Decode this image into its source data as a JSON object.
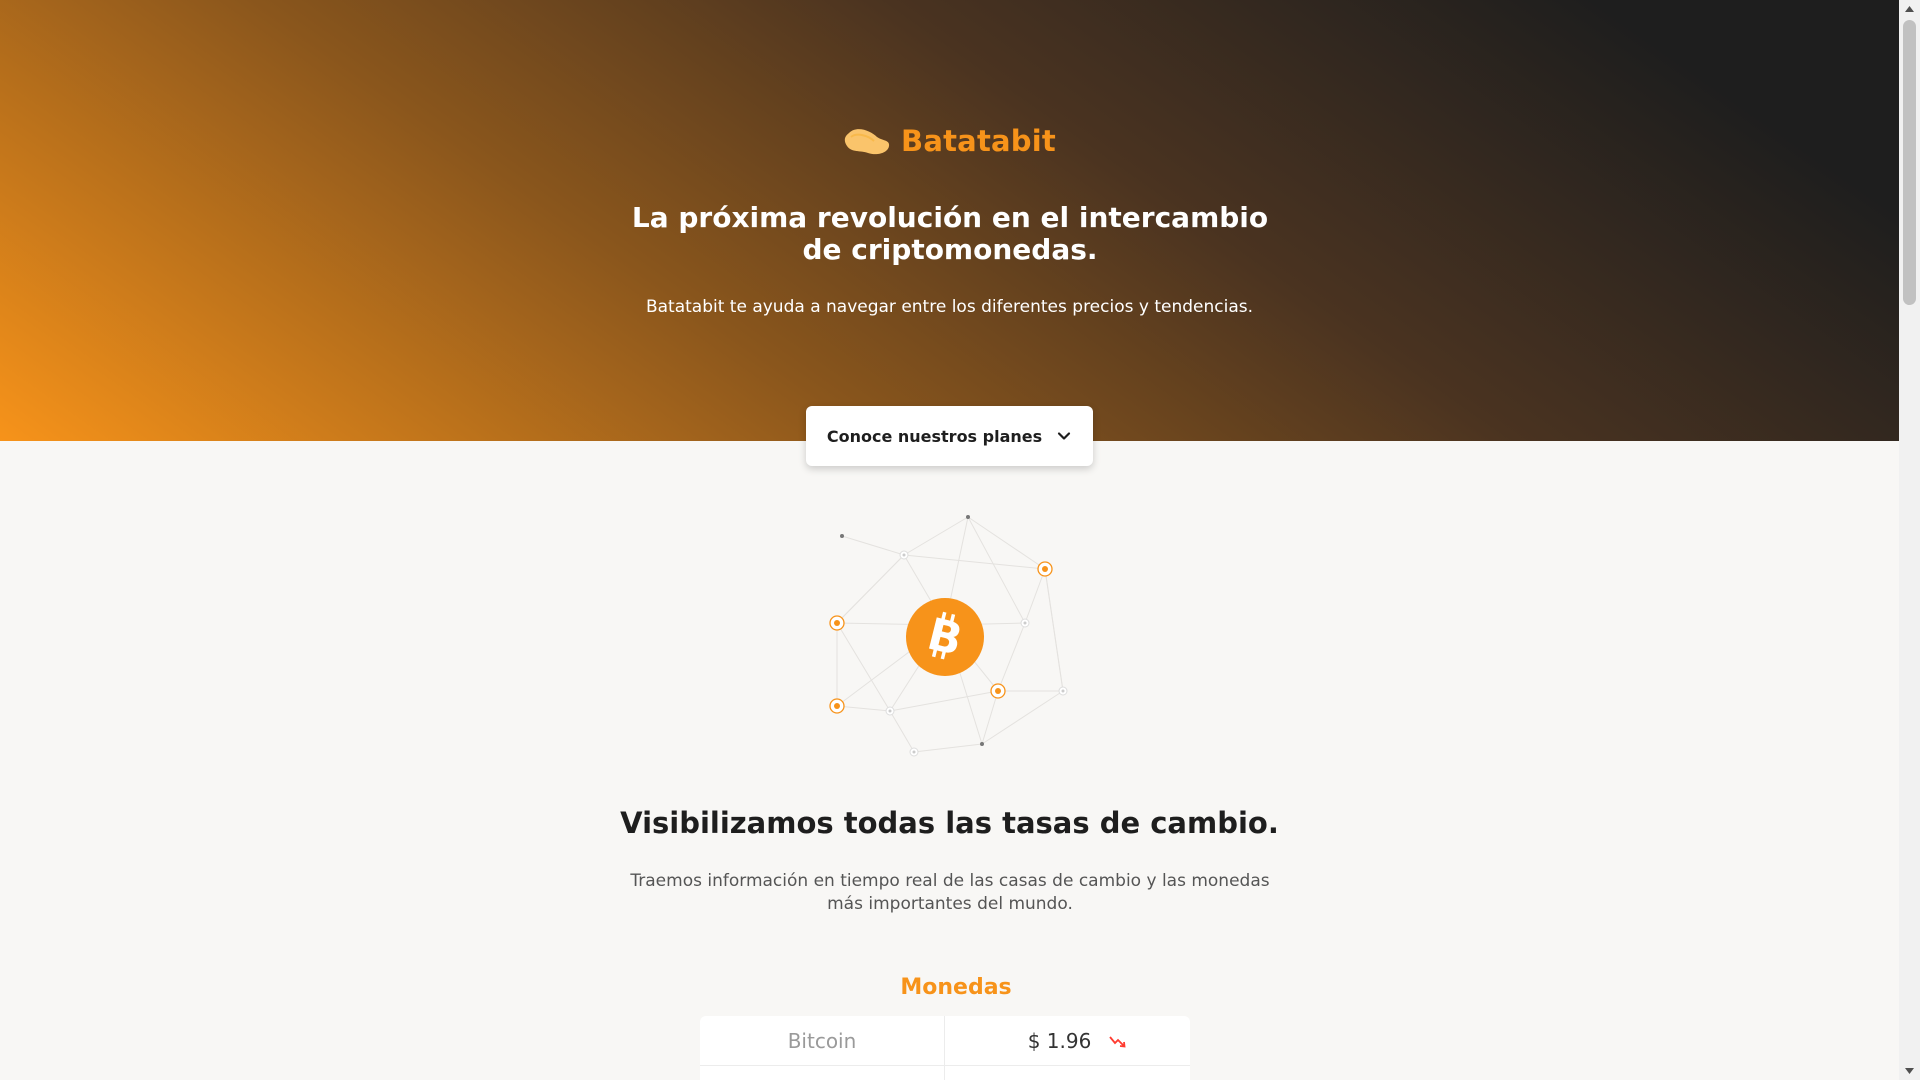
{
  "brand": {
    "name": "Batatabit",
    "logo_icon": "potato-logo-icon",
    "accent_color": "#f7931a",
    "dark_color": "#1e1e1e"
  },
  "hero": {
    "title": "La próxima revolución en el intercambio de criptomonedas.",
    "subtitle": "Batatabit te ayuda a navegar entre los diferentes precios y tendencias.",
    "cta_label": "Conoce nuestros planes",
    "cta_icon": "chevron-down-icon"
  },
  "illustration": {
    "icon": "bitcoin-network-icon"
  },
  "rates": {
    "title": "Visibilizamos todas las tasas de cambio.",
    "description": "Traemos información en tiempo real de las casas de cambio y las monedas más importantes del mundo."
  },
  "coins": {
    "title": "Monedas",
    "rows": [
      {
        "name": "Bitcoin",
        "price": "$ 1.96",
        "trend": "down",
        "trend_icon": "trend-down-icon",
        "trend_color": "#ff3b30"
      }
    ]
  }
}
